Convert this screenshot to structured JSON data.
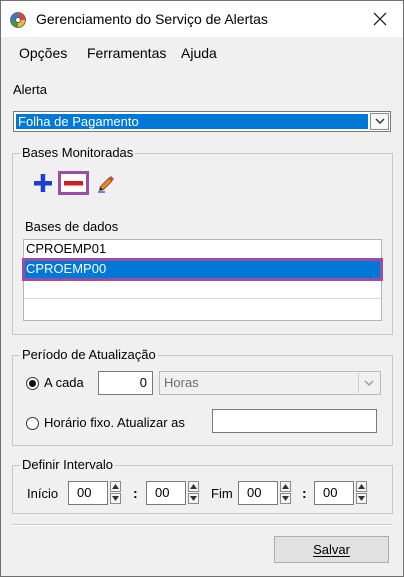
{
  "window": {
    "title": "Gerenciamento do Serviço de Alertas"
  },
  "menu": {
    "items": [
      "Opções",
      "Ferramentas",
      "Ajuda"
    ]
  },
  "alerta": {
    "label": "Alerta",
    "selected": "Folha de Pagamento"
  },
  "bases": {
    "group_title": "Bases Monitoradas",
    "tools": [
      "plus-icon",
      "minus-icon",
      "pencil-icon"
    ],
    "list_header": "Bases de dados",
    "rows": [
      "CPROEMP01",
      "CPROEMP00",
      "",
      ""
    ],
    "selected_row": "CPROEMP00"
  },
  "periodo": {
    "group_title": "Período de Atualização",
    "option_acada": "A cada",
    "interval_value": "0",
    "unit_selected": "Horas",
    "option_fixo": "Horário fixo. Atualizar as",
    "fixo_value": ""
  },
  "intervalo": {
    "group_title": "Definir Intervalo",
    "inicio_label": "Início",
    "fim_label": "Fim",
    "inicio_hour": "00",
    "inicio_minute": "00",
    "fim_hour": "00",
    "fim_minute": "00",
    "separator": ":"
  },
  "actions": {
    "save_label": "Salvar"
  },
  "colors": {
    "selection": "#0078d7",
    "highlight_outline": "#9b4ea6",
    "plus_blue": "#1c3fd0",
    "minus_red": "#d21d1d"
  }
}
